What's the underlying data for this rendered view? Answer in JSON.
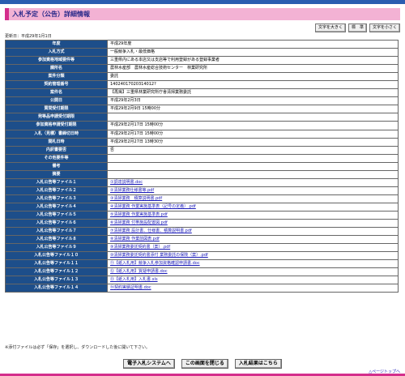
{
  "header": {
    "title": "入札予定（公告）詳細情報"
  },
  "font_buttons": [
    "文字を大きく",
    "標　準",
    "文字を小さく"
  ],
  "updated": "更新日：平成29年1月1日",
  "rows": [
    {
      "label": "年度",
      "value": "平成29年度",
      "link": false
    },
    {
      "label": "入札方式",
      "value": "一般競争入札・最低価格",
      "link": false
    },
    {
      "label": "参加資格地域要件等",
      "value": "三重県内にある本店又は支店等で利用登録がある登録事業者",
      "link": false
    },
    {
      "label": "課所名",
      "value": "農林水産部　農林水産総合技術センター　林業研究所",
      "link": false
    },
    {
      "label": "案件分類",
      "value": "委託",
      "link": false
    },
    {
      "label": "契約管理番号",
      "value": "14024017020314012?",
      "link": false
    },
    {
      "label": "案件名",
      "value": "【再掲】三重県林業研究所庁舎清掃業務委託",
      "link": false
    },
    {
      "label": "公開日",
      "value": "平成29年2月3日",
      "link": false
    },
    {
      "label": "質問受付期限",
      "value": "平成29年2月9日 15時00分",
      "link": false
    },
    {
      "label": "発等品申請受付期限",
      "value": "",
      "link": false
    },
    {
      "label": "参加資格申請受付期限",
      "value": "平成29年2月17日 15時00分",
      "link": false
    },
    {
      "label": "入札（見積）書締切日時",
      "value": "平成29年2月17日 15時00分",
      "link": false
    },
    {
      "label": "開札日時",
      "value": "平成29年2月27日 13時30分",
      "link": false
    },
    {
      "label": "内訳書要否",
      "value": "否",
      "link": false
    },
    {
      "label": "その他要件等",
      "value": "",
      "link": false
    },
    {
      "label": "備考",
      "value": "",
      "link": false
    },
    {
      "label": "摘要",
      "value": "",
      "link": false
    },
    {
      "label": "入札公告等ファイル１",
      "value": "①調達説明書.doc",
      "link": true
    },
    {
      "label": "入札公告等ファイル２",
      "value": "②清掃業務仕様書等.pdf",
      "link": true
    },
    {
      "label": "入札公告等ファイル３",
      "value": "③清掃業務　積算説明書.pdf",
      "link": true
    },
    {
      "label": "入札公告等ファイル４",
      "value": "④清掃業務 作業実施基準表（記号の定義）.pdf",
      "link": true
    },
    {
      "label": "入札公告等ファイル５",
      "value": "⑤清掃業務 作業実施基準表.pdf",
      "link": true
    },
    {
      "label": "入札公告等ファイル６",
      "value": "⑥清掃業務 付帯施設配置図.pdf",
      "link": true
    },
    {
      "label": "入札公告等ファイル７",
      "value": "⑦清掃業務 設計書、仕様書、積算説明書.pdf",
      "link": true
    },
    {
      "label": "入札公告等ファイル８",
      "value": "⑧清掃業務 作業前図表.pdf",
      "link": true
    },
    {
      "label": "入札公告等ファイル９",
      "value": "⑨清掃業務委託契約書（案）.pdf",
      "link": true
    },
    {
      "label": "入札公告等ファイル１０",
      "value": "⑩清掃業務委託契約書添付 業務委託の保険（案）.pdf",
      "link": true
    },
    {
      "label": "入札公告等ファイル１１",
      "value": "⑪【紙入札用】競争入札参加資格確認申請書.doc",
      "link": true
    },
    {
      "label": "入札公告等ファイル１２",
      "value": "⑫【紙入札用】質疑申請書.doc",
      "link": true
    },
    {
      "label": "入札公告等ファイル１３",
      "value": "⑬【紙入札用】入札書.xls",
      "link": true
    },
    {
      "label": "入札公告等ファイル１４",
      "value": "⑭契約実績証明書.doc",
      "link": true
    }
  ],
  "note": "※添付ファイルは必ず「保存」を選択し、ダウンロードした後に開いて下さい。",
  "bottom_buttons": [
    "電子入札システムへ",
    "この画面を閉じる",
    "入札結果はこちら"
  ],
  "page_top": "△ページトップへ",
  "colors": {
    "label_bg": "#1d4e8a",
    "title_bg": "#f3b2d4",
    "accent": "#d42e8c",
    "link": "#1a1ab8"
  }
}
